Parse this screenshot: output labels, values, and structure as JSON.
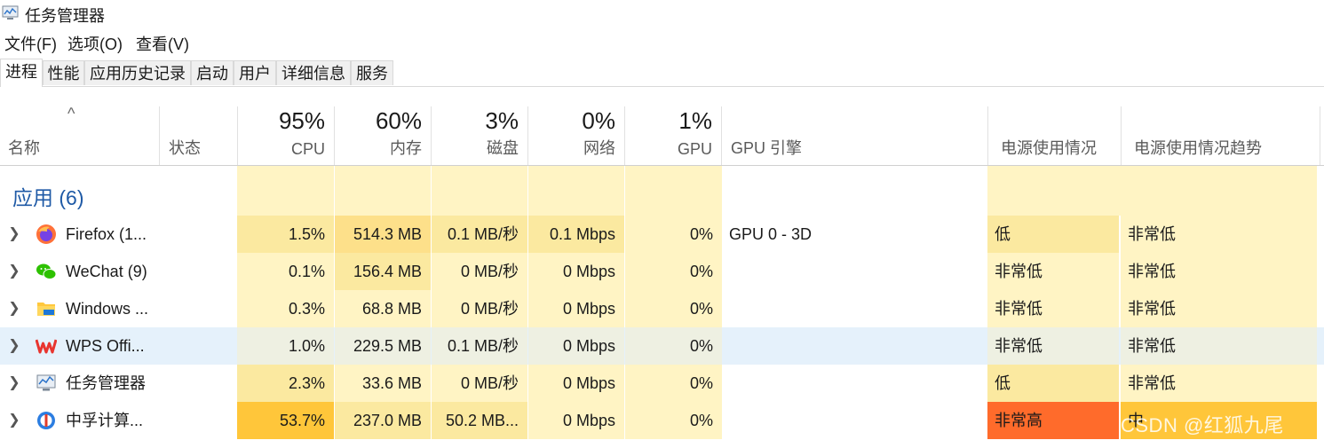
{
  "window": {
    "title": "任务管理器",
    "icon": "task-manager-icon"
  },
  "menu": [
    {
      "label": "文件(F)"
    },
    {
      "label": "选项(O)"
    },
    {
      "label": "查看(V)"
    }
  ],
  "tabs": [
    {
      "label": "进程",
      "active": true
    },
    {
      "label": "性能"
    },
    {
      "label": "应用历史记录"
    },
    {
      "label": "启动"
    },
    {
      "label": "用户"
    },
    {
      "label": "详细信息"
    },
    {
      "label": "服务"
    }
  ],
  "header": {
    "sort_indicator": "^",
    "name": {
      "label": "名称"
    },
    "status": {
      "label": "状态"
    },
    "cpu": {
      "percent": "95%",
      "label": "CPU"
    },
    "memory": {
      "percent": "60%",
      "label": "内存"
    },
    "disk": {
      "percent": "3%",
      "label": "磁盘"
    },
    "network": {
      "percent": "0%",
      "label": "网络"
    },
    "gpu": {
      "percent": "1%",
      "label": "GPU"
    },
    "gpu_engine": {
      "label": "GPU 引擎"
    },
    "power": {
      "label": "电源使用情况"
    },
    "power_trend": {
      "label": "电源使用情况趋势"
    }
  },
  "group": {
    "title": "应用 (6)"
  },
  "rows": [
    {
      "name": "Firefox (1...",
      "icon": "firefox-icon",
      "cpu": "1.5%",
      "memory": "514.3 MB",
      "disk": "0.1 MB/秒",
      "network": "0.1 Mbps",
      "gpu": "0%",
      "gpu_engine": "GPU 0 - 3D",
      "power": "低",
      "power_trend": "非常低"
    },
    {
      "name": "WeChat (9)",
      "icon": "wechat-icon",
      "cpu": "0.1%",
      "memory": "156.4 MB",
      "disk": "0 MB/秒",
      "network": "0 Mbps",
      "gpu": "0%",
      "gpu_engine": "",
      "power": "非常低",
      "power_trend": "非常低"
    },
    {
      "name": "Windows ...",
      "icon": "file-explorer-icon",
      "cpu": "0.3%",
      "memory": "68.8 MB",
      "disk": "0 MB/秒",
      "network": "0 Mbps",
      "gpu": "0%",
      "gpu_engine": "",
      "power": "非常低",
      "power_trend": "非常低"
    },
    {
      "name": "WPS Offi...",
      "icon": "wps-office-icon",
      "cpu": "1.0%",
      "memory": "229.5 MB",
      "disk": "0.1 MB/秒",
      "network": "0 Mbps",
      "gpu": "0%",
      "gpu_engine": "",
      "power": "非常低",
      "power_trend": "非常低"
    },
    {
      "name": "任务管理器",
      "icon": "task-manager-icon",
      "cpu": "2.3%",
      "memory": "33.6 MB",
      "disk": "0 MB/秒",
      "network": "0 Mbps",
      "gpu": "0%",
      "gpu_engine": "",
      "power": "低",
      "power_trend": "非常低"
    },
    {
      "name": "中孚计算...",
      "icon": "zhongfu-icon",
      "cpu": "53.7%",
      "memory": "237.0 MB",
      "disk": "50.2 MB...",
      "network": "0 Mbps",
      "gpu": "0%",
      "gpu_engine": "",
      "power": "非常高",
      "power_trend": "中"
    }
  ],
  "colors": {
    "heat_light": "#fff4c4",
    "heat_mid": "#fbe9a0",
    "heat_mem_high": "#fde08a",
    "heat_cpu_high": "#ffc63a",
    "power_very_high": "#ff6b2b",
    "hover_row": "#e5f1fb",
    "group_title": "#1f5aa6"
  },
  "watermark": "CSDN @红狐九尾"
}
